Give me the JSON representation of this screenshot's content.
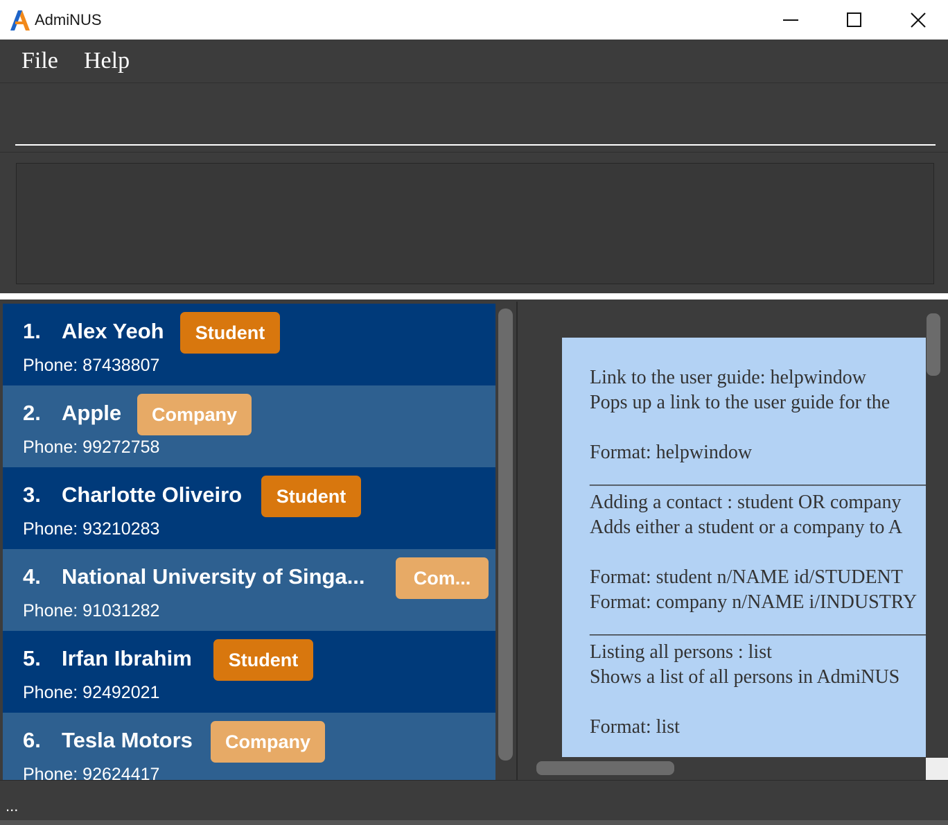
{
  "window": {
    "title": "AdmiNUS",
    "controls": {
      "minimize": "minimize",
      "maximize": "maximize",
      "close": "close"
    }
  },
  "menu": {
    "items": [
      "File",
      "Help"
    ]
  },
  "command_box": {
    "value": "",
    "placeholder": ""
  },
  "result_display": {
    "text": ""
  },
  "colors": {
    "card_dark": "#003a7a",
    "card_light": "#2e6090",
    "tag_student": "#d8770e",
    "tag_company": "#e7aa66",
    "help_bg": "#b3d2f4"
  },
  "person_list": [
    {
      "index": "1.",
      "name": "Alex Yeoh",
      "tag": "Student",
      "phone": "Phone: 87438807"
    },
    {
      "index": "2.",
      "name": "Apple",
      "tag": "Company",
      "phone": "Phone: 99272758"
    },
    {
      "index": "3.",
      "name": "Charlotte Oliveiro",
      "tag": "Student",
      "phone": "Phone: 93210283"
    },
    {
      "index": "4.",
      "name": "National University of Singa...",
      "tag": "Com...",
      "phone": "Phone: 91031282"
    },
    {
      "index": "5.",
      "name": "Irfan Ibrahim",
      "tag": "Student",
      "phone": "Phone: 92492021"
    },
    {
      "index": "6.",
      "name": "Tesla Motors",
      "tag": "Company",
      "phone": "Phone: 92624417"
    }
  ],
  "help": {
    "lines": [
      "Link to the user guide: helpwindow",
      "Pops up a link to the user guide for the",
      "",
      "Format: helpwindow",
      "_______________________________________",
      "Adding a contact : student OR company",
      "Adds either a student or a company to A",
      "",
      "Format: student n/NAME id/STUDENT",
      "Format: company n/NAME i/INDUSTRY",
      "_______________________________________",
      "Listing all persons : list",
      "Shows a list of all persons in AdmiNUS",
      "",
      "Format: list"
    ]
  },
  "status": {
    "text": "..."
  }
}
